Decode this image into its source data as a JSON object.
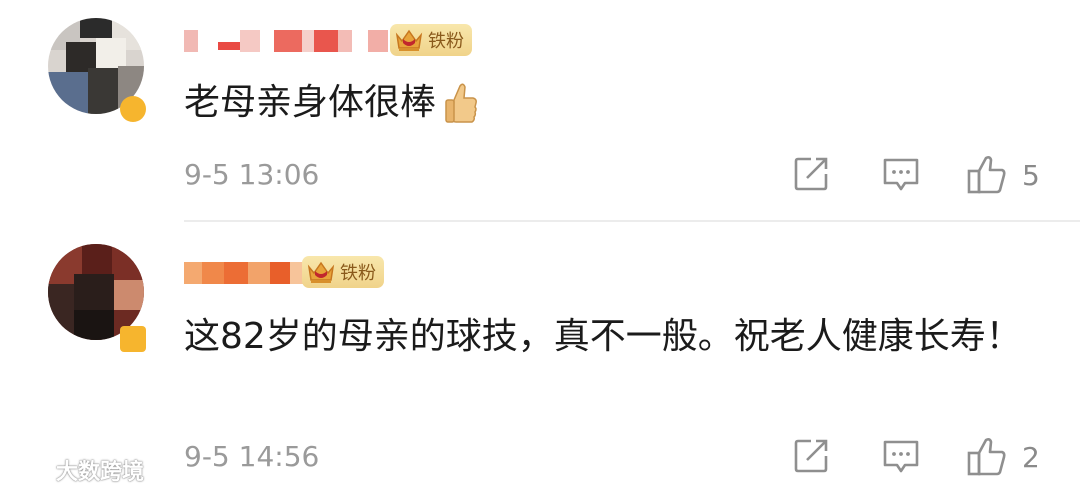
{
  "comments": [
    {
      "badge_label": "铁粉",
      "text": "老母亲身体很棒",
      "emoji": "thumbs-up-emoji",
      "time": "9-5 13:06",
      "like_count": "5"
    },
    {
      "badge_label": "铁粉",
      "text": "这82岁的母亲的球技，真不一般。祝老人健康长寿！",
      "time": "9-5 14:56",
      "like_count": "2"
    }
  ],
  "icons": {
    "share": "share-icon",
    "comment": "comment-icon",
    "like": "like-icon",
    "badge": "crown-icon"
  },
  "watermark": {
    "text": "大数跨境"
  },
  "colors": {
    "badge_bg": "#f3dc97",
    "badge_text": "#8a5a1c",
    "meta_gray": "#9a9a9a",
    "divider": "#ececec"
  }
}
